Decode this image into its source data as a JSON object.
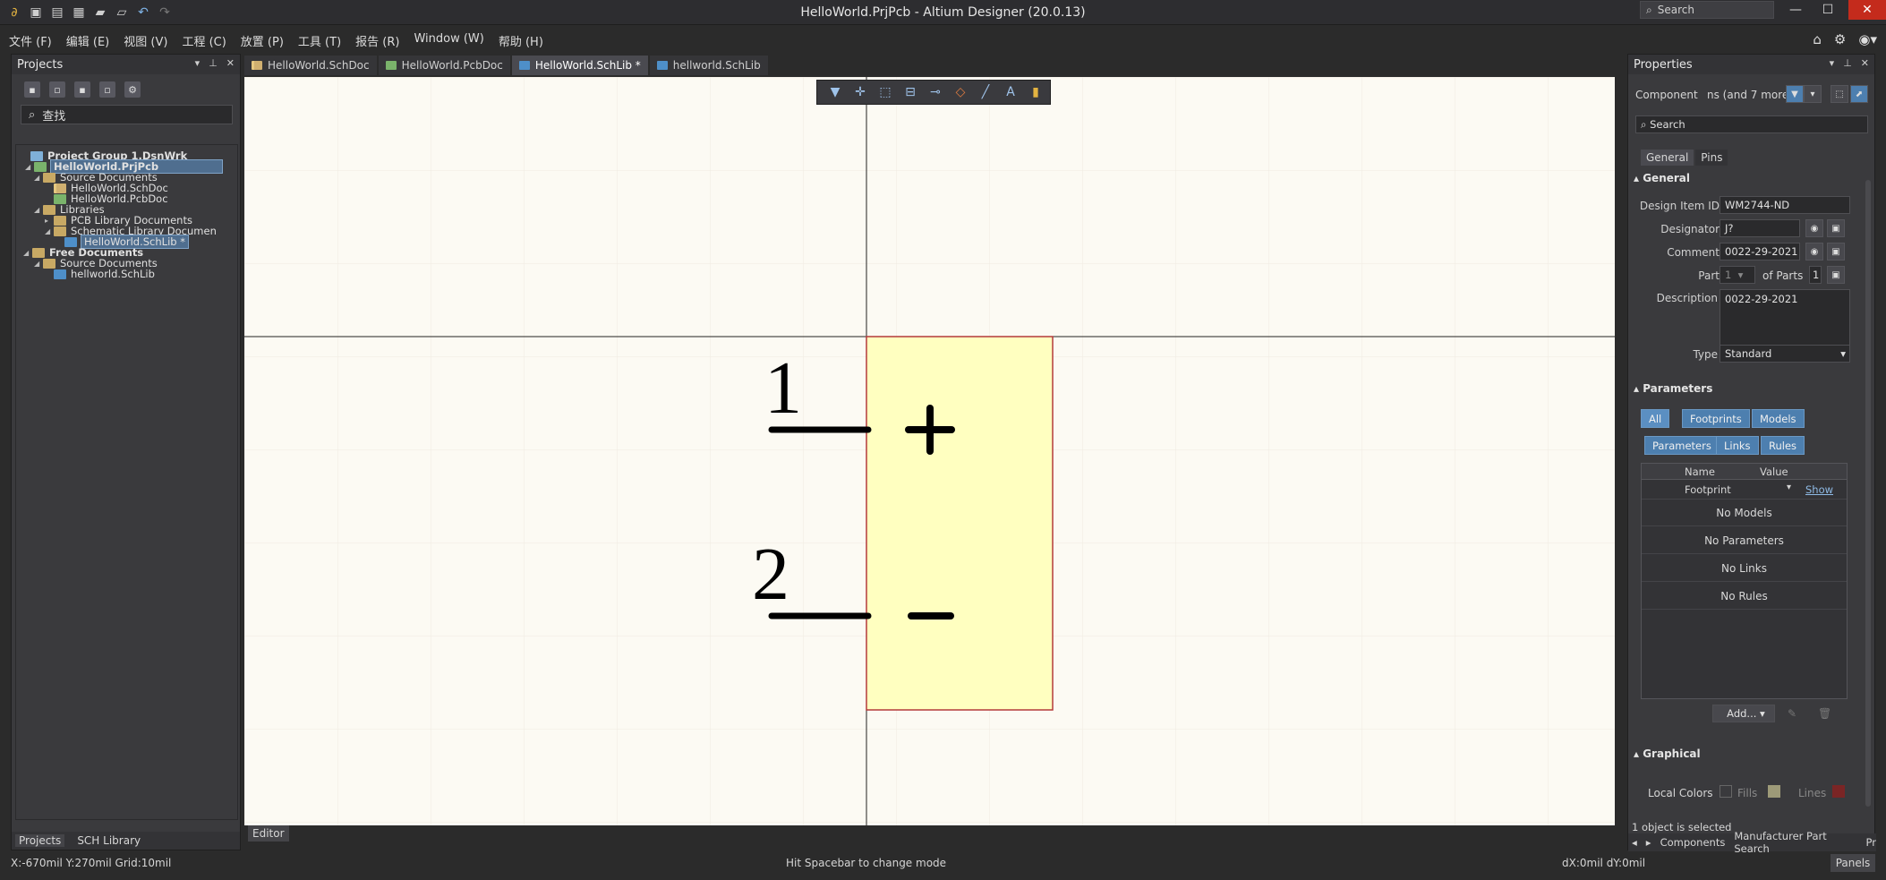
{
  "window": {
    "title": "HelloWorld.PrjPcb - Altium Designer (20.0.13)",
    "search_placeholder": "Search"
  },
  "menu": [
    "文件 (F)",
    "编辑 (E)",
    "视图 (V)",
    "工程 (C)",
    "放置 (P)",
    "工具 (T)",
    "报告 (R)",
    "Window (W)",
    "帮助 (H)"
  ],
  "projects": {
    "title": "Projects",
    "search": "查找",
    "tree": [
      {
        "label": "Project Group 1.DsnWrk",
        "icon": "f-proj",
        "bold": true
      },
      {
        "label": "HelloWorld.PrjPcb",
        "icon": "f-pcb",
        "bold": true
      },
      {
        "label": "Source Documents",
        "icon": "f-folder"
      },
      {
        "label": "HelloWorld.SchDoc",
        "icon": "f-sch"
      },
      {
        "label": "HelloWorld.PcbDoc",
        "icon": "f-pcb"
      },
      {
        "label": "Libraries",
        "icon": "f-folder"
      },
      {
        "label": "PCB Library Documents",
        "icon": "f-folder"
      },
      {
        "label": "Schematic Library Documen",
        "icon": "f-folder"
      },
      {
        "label": "HelloWorld.SchLib *",
        "icon": "f-lib"
      },
      {
        "label": "Free Documents",
        "icon": "f-folder",
        "bold": true
      },
      {
        "label": "Source Documents",
        "icon": "f-folder"
      },
      {
        "label": "hellworld.SchLib",
        "icon": "f-lib"
      }
    ],
    "bottom_tabs": [
      "Projects",
      "SCH Library"
    ]
  },
  "doc_tabs": [
    {
      "label": "HelloWorld.SchDoc",
      "icon": "f-sch"
    },
    {
      "label": "HelloWorld.PcbDoc",
      "icon": "f-pcb"
    },
    {
      "label": "HelloWorld.SchLib *",
      "icon": "f-lib"
    },
    {
      "label": "hellworld.SchLib",
      "icon": "f-lib"
    }
  ],
  "editor": {
    "tab": "Editor",
    "pin1_number": "1",
    "pin2_number": "2",
    "pin1_name": "+",
    "pin2_name": "−",
    "body_color": "#ffffc0",
    "body_border": "#b33a3a"
  },
  "properties": {
    "title": "Properties",
    "filter_label": "Component",
    "filter_value": "ns (and 7 more)",
    "search": "Search",
    "tabs": [
      "General",
      "Pins"
    ],
    "section_general": "General",
    "design_item_label": "Design Item ID",
    "design_item": "WM2744-ND",
    "designator_label": "Designator",
    "designator": "J?",
    "comment_label": "Comment",
    "comment": "0022-29-2021",
    "part_label": "Part",
    "part_value": "1",
    "of_parts_label": "of Parts",
    "of_parts": "1",
    "description_label": "Description",
    "description": "0022-29-2021",
    "type_label": "Type",
    "type_value": "Standard",
    "section_parameters": "Parameters",
    "chips_row1": [
      "All",
      "Footprints",
      "Models"
    ],
    "chips_row2": [
      "Parameters",
      "Links",
      "Rules"
    ],
    "col_name": "Name",
    "col_value": "Value",
    "footprint": "Footprint",
    "show": "Show",
    "empty_rows": [
      "No Models",
      "No Parameters",
      "No Links",
      "No Rules"
    ],
    "add_button": "Add...",
    "section_graphical": "Graphical",
    "local_colors": "Local Colors",
    "fills": "Fills",
    "lines": "Lines",
    "selected": "1 object is selected",
    "bottom_tabs": [
      "Components",
      "Manufacturer Part Search",
      "Pr"
    ]
  },
  "status": {
    "coords": "X:-670mil Y:270mil    Grid:10mil",
    "hint": "Hit Spacebar to change mode",
    "delta": "dX:0mil dY:0mil",
    "panels": "Panels"
  }
}
